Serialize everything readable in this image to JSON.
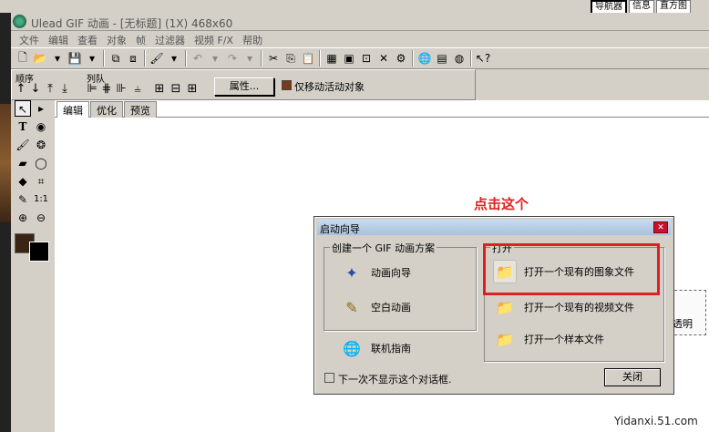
{
  "window": {
    "title": "Ulead GIF 动画 - [无标题] (1X) 468x60"
  },
  "right_tabs": [
    "导航器",
    "信息",
    "直方图"
  ],
  "menu": [
    "文件",
    "编辑",
    "查看",
    "对象",
    "帧",
    "过滤器",
    "视频 F/X",
    "帮助"
  ],
  "order_row": {
    "order_label": "顺序",
    "align_label": "列队",
    "properties_button": "属性...",
    "move_active_label": "仅移动活动对象"
  },
  "tabs": [
    "编辑",
    "优化",
    "预览"
  ],
  "annotation": "点击这个",
  "right_object_label": "透明",
  "dialog": {
    "title": "启动向导",
    "create_group_label": "创建一个 GIF 动画方案",
    "open_group_label": "打开",
    "create_items": [
      "动画向导",
      "空白动画",
      "联机指南"
    ],
    "open_items": [
      "打开一个现有的图象文件",
      "打开一个现有的视频文件",
      "打开一个样本文件"
    ],
    "dont_show_label": "下一次不显示这个对话框.",
    "close_button": "关闭"
  },
  "watermark": "Yidanxi.51.com"
}
